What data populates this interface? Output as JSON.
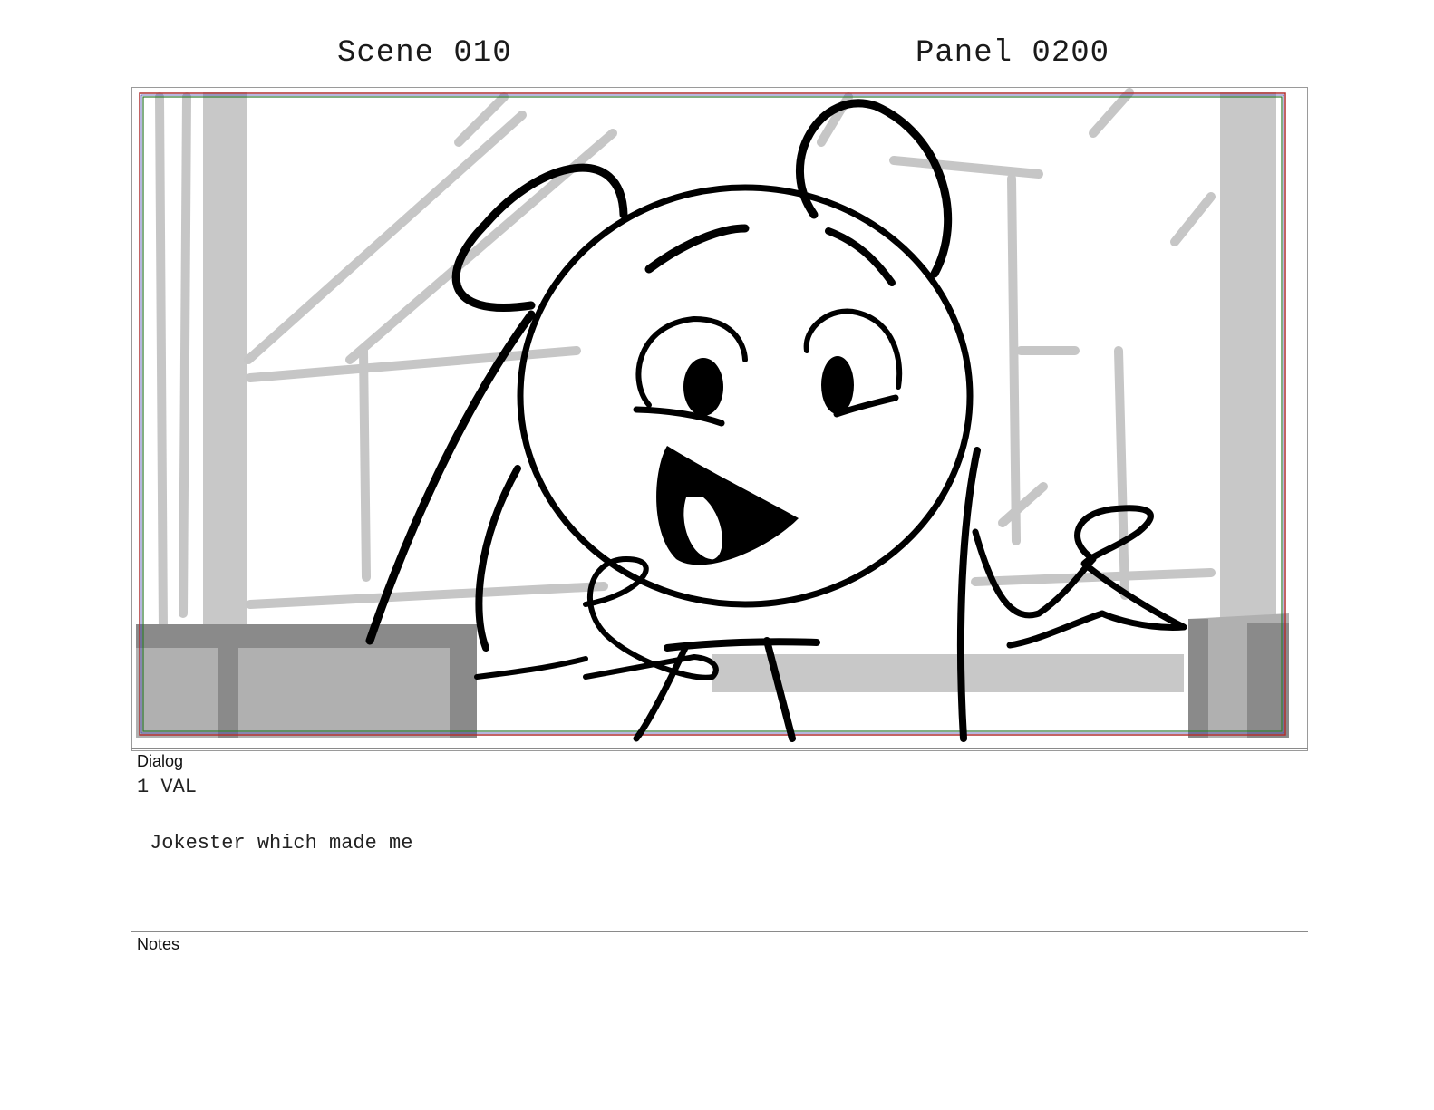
{
  "header": {
    "scene": "Scene 010",
    "panel": "Panel 0200"
  },
  "panel_image": {
    "description_icon": "storyboard-sketch"
  },
  "dialog": {
    "label": "Dialog",
    "character_line": "1 VAL",
    "text": "Jokester which made me"
  },
  "notes": {
    "label": "Notes"
  },
  "colors": {
    "safe_area_red": "#b03030",
    "safe_area_green": "#2f7a2f",
    "safe_area_blue": "#4a4ab0"
  }
}
